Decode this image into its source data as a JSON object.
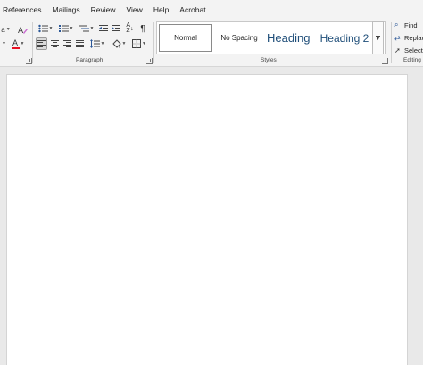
{
  "menu": {
    "tabs": [
      "References",
      "Mailings",
      "Review",
      "View",
      "Help",
      "Acrobat"
    ]
  },
  "font_group": {
    "fragment_text": "a"
  },
  "paragraph": {
    "label": "Paragraph",
    "pilcrow": "¶"
  },
  "styles": {
    "label": "Styles",
    "items": [
      {
        "name": "Normal",
        "selected": true
      },
      {
        "name": "No Spacing",
        "selected": false
      },
      {
        "name": "Heading",
        "selected": false
      },
      {
        "name": "Heading 2",
        "selected": false
      }
    ]
  },
  "editing": {
    "label": "Editing",
    "find": "Find",
    "replace": "Replac",
    "select": "Select"
  },
  "colors": {
    "font_color_bar": "#e81123",
    "heading_color": "#1f4e79"
  },
  "icons": {
    "clear_format": "clear-formatting-icon",
    "font_color": "font-color-icon",
    "bullets": "bullets-icon",
    "numbering": "numbering-icon",
    "multilevel": "multilevel-list-icon",
    "decrease_indent": "decrease-indent-icon",
    "increase_indent": "increase-indent-icon",
    "sort": "sort-icon",
    "show_marks": "pilcrow-icon",
    "align_left": "align-left-icon",
    "center": "align-center-icon",
    "align_right": "align-right-icon",
    "justify": "justify-icon",
    "line_spacing": "line-spacing-icon",
    "shading": "shading-icon",
    "borders": "borders-icon",
    "find": "search-icon",
    "replace": "replace-icon",
    "select": "cursor-icon"
  }
}
